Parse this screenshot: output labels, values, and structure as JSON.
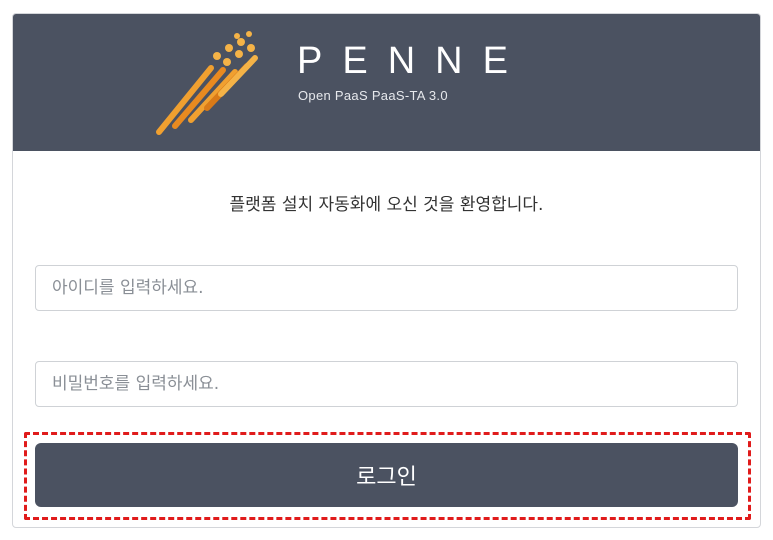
{
  "header": {
    "brand_name": "PENNE",
    "brand_subtitle": "Open PaaS PaaS-TA 3.0",
    "logo_icon": "streak-logo-icon",
    "background_color": "#4b5261",
    "accent_color": "#f0a030"
  },
  "main": {
    "welcome_text": "플랫폼 설치 자동화에 오신 것을 환영합니다.",
    "id_placeholder": "아이디를 입력하세요.",
    "password_placeholder": "비밀번호를 입력하세요.",
    "login_label": "로그인"
  },
  "highlight_color": "#e01b1b"
}
